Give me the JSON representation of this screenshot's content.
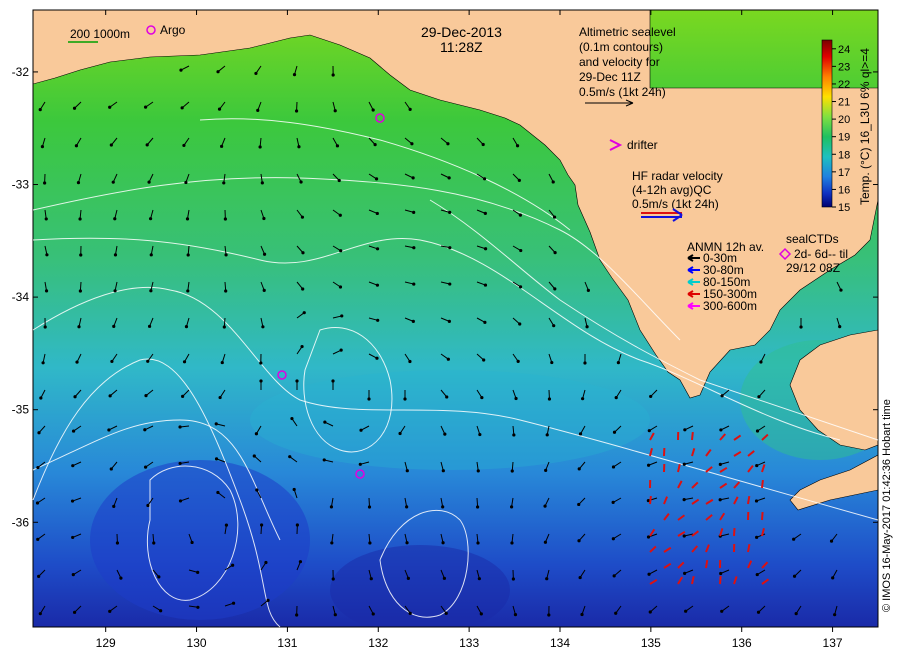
{
  "date": "29-Dec-2013",
  "time": "11:28Z",
  "scale_label": "200  1000m",
  "argo_label": "Argo",
  "altimetry_text": [
    "Altimetric sealevel",
    "(0.1m contours)",
    "and velocity for",
    "29-Dec 11Z",
    "0.5m/s (1kt 24h)"
  ],
  "drifter_label": "drifter",
  "hf_text": [
    "HF radar velocity",
    "(4-12h avg)QC",
    "0.5m/s (1kt 24h)"
  ],
  "anmn": {
    "title": "ANMN 12h av.",
    "items": [
      {
        "label": "0-30m",
        "color": "#000000"
      },
      {
        "label": "30-80m",
        "color": "#0000ff"
      },
      {
        "label": "80-150m",
        "color": "#00cccc"
      },
      {
        "label": "150-300m",
        "color": "#dd0000"
      },
      {
        "label": "300-600m",
        "color": "#ff00ff"
      }
    ]
  },
  "sealctd": [
    "sealCTDs",
    "2d- 6d-- til",
    "29/12 08Z"
  ],
  "colorbar": {
    "label": "Temp. (°C) 16_L3U 6% ql>=4",
    "ticks": [
      "24",
      "23",
      "22",
      "21",
      "20",
      "19",
      "18",
      "17",
      "16",
      "15"
    ],
    "min": 15,
    "max": 24.5
  },
  "x_ticks": [
    "129",
    "130",
    "131",
    "132",
    "133",
    "134",
    "135",
    "136",
    "137"
  ],
  "y_ticks": [
    "-32",
    "-33",
    "-34",
    "-35",
    "-36"
  ],
  "lon_range": [
    128.2,
    137.5
  ],
  "lat_range": [
    -31.45,
    -36.93
  ],
  "credit": "© IMOS 16-May-2017 01:42:36 Hobart time",
  "colors": {
    "land": "#f9c99a",
    "green": "#3cc83c",
    "cyan": "#28b4d2",
    "blue": "#1e3cc8",
    "argo": "#e000e0",
    "radar": "#dd1111"
  }
}
